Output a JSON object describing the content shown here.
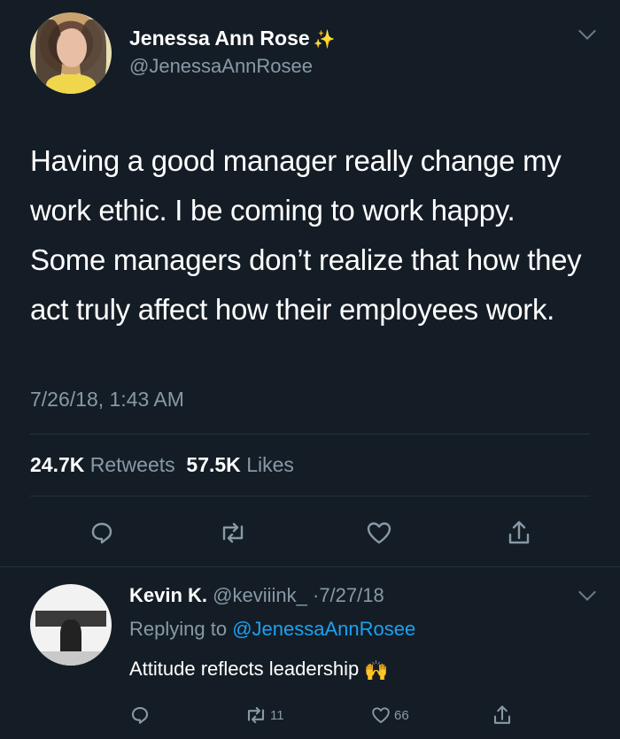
{
  "tweet": {
    "author_name": "Jenessa Ann Rose",
    "author_emoji": "✨",
    "author_handle": "@JenessaAnnRosee",
    "text": "Having a good manager really change my work ethic. I be coming to work happy. Some managers don’t realize that how they act truly affect how their employees work.",
    "timestamp": "7/26/18, 1:43 AM",
    "retweet_count": "24.7K",
    "retweet_label": "Retweets",
    "like_count": "57.5K",
    "like_label": "Likes",
    "icons": [
      "reply-icon",
      "retweet-icon",
      "like-icon",
      "share-icon"
    ]
  },
  "reply": {
    "author_name": "Kevin K.",
    "author_handle": "@keviiink_",
    "date_sep": "·",
    "date": "7/27/18",
    "replying_prefix": "Replying to",
    "replying_to": "@JenessaAnnRosee",
    "text": "Attitude reflects leadership",
    "emoji": "🙌",
    "retweet_count": "11",
    "like_count": "66"
  },
  "colors": {
    "background": "#141d26",
    "muted": "#8899a6",
    "link": "#1da1f2"
  }
}
